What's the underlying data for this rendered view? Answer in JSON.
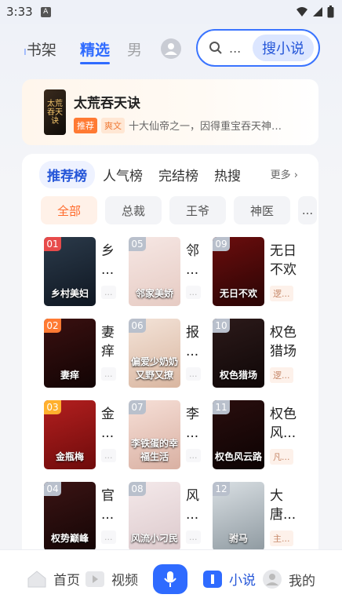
{
  "status_bar": {
    "time": "3:33",
    "notif_badge": "A"
  },
  "top_nav": {
    "tabs": [
      "书架",
      "精选",
      "男"
    ],
    "active_tab": "精选",
    "search_placeholder": "...",
    "search_button": "搜小说"
  },
  "featured": {
    "title": "太荒吞天诀",
    "tag1": "推荐",
    "tag2": "爽文",
    "desc": "十大仙帝之一，因得重宝吞天神…",
    "cover_text": "太荒吞天诀"
  },
  "rank": {
    "tabs": [
      "推荐榜",
      "人气榜",
      "完结榜",
      "热搜"
    ],
    "more": "更多",
    "categories": [
      "全部",
      "总裁",
      "王爷",
      "神医",
      "..."
    ],
    "books": [
      {
        "num": "01",
        "title_1": "乡",
        "title_2": "...",
        "tag": "...",
        "cover_text": "乡村美妇",
        "color": "#e74b4b"
      },
      {
        "num": "05",
        "title_1": "邻",
        "title_2": "...",
        "tag": "...",
        "cover_text": "邻家美娇",
        "color": "#b9c0cc"
      },
      {
        "num": "09",
        "title_1": "无日",
        "title_2": "不欢",
        "tag": "逻...",
        "cover_text": "无日不欢",
        "color": "#b9c0cc"
      },
      {
        "num": "02",
        "title_1": "妻",
        "title_2": "痒",
        "tag": "...",
        "cover_text": "妻痒",
        "color": "#ff7a33"
      },
      {
        "num": "06",
        "title_1": "报",
        "title_2": "...",
        "tag": "...",
        "cover_text": "偏爱少奶奶又野又撩",
        "color": "#b9c0cc"
      },
      {
        "num": "10",
        "title_1": "权色",
        "title_2": "猎场",
        "tag": "逻...",
        "cover_text": "权色猎场",
        "color": "#b9c0cc"
      },
      {
        "num": "03",
        "title_1": "金",
        "title_2": "...",
        "tag": "...",
        "cover_text": "金瓶梅",
        "color": "#ffb02e"
      },
      {
        "num": "07",
        "title_1": "李",
        "title_2": "...",
        "tag": "...",
        "cover_text": "李铁蛋的幸福生活",
        "color": "#b9c0cc"
      },
      {
        "num": "11",
        "title_1": "权色",
        "title_2": "风...",
        "tag": "凡...",
        "cover_text": "权色风云路",
        "color": "#b9c0cc"
      },
      {
        "num": "04",
        "title_1": "官",
        "title_2": "...",
        "tag": "...",
        "cover_text": "权势巅峰",
        "color": "#b9c0cc"
      },
      {
        "num": "08",
        "title_1": "风",
        "title_2": "...",
        "tag": "...",
        "cover_text": "风流小刁民",
        "color": "#b9c0cc"
      },
      {
        "num": "12",
        "title_1": "大",
        "title_2": "唐...",
        "tag": "主...",
        "cover_text": "驸马",
        "color": "#b9c0cc"
      }
    ]
  },
  "bottom_tabs": {
    "home": "首页",
    "video": "视频",
    "novel": "小说",
    "mine": "我的"
  }
}
